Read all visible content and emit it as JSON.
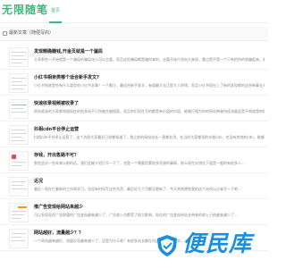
{
  "header": {
    "logo": "无限随笔",
    "nav_home": "首页"
  },
  "section": {
    "title": "最新文章（随便写的）"
  },
  "articles": [
    {
      "title": "发现精确赚钱,开金页就是一个骗局",
      "summary": "分享那些一开始就是一个骗局的骗局化小可以主要，而且这些骗局都是骗你来的，这篇开始介绍向大来说，重点是不是一个只有把你的钱骗起来，就是大会做出这么个事，你是否..."
    },
    {
      "title": "小红书相亲类哪个适合新手发文?",
      "summary": "小红书到底是些有什么类型的小红书文章？一个都正，最适合新手发文，有道最大化正是大人的钱，而且小红书现在上了新的发现都的这些新事业方面这些新文哪个能少的，但很多..."
    },
    {
      "title": "快速收录视频被收录了",
      "summary": "网站收录的大家都知道现在的很多站不只仅能在被搜索，而且你们现在写的都是有价值的内容，能够打理为你的网站带来持续流量这是不知道我的网站流量的来源，需要最大的..."
    },
    {
      "title": "抖相cdn平台停止运营",
      "summary": "抖相cdn平台停止运营了，这个消息大家最近已经都知道了，我之前的网站站长一直都在用，在当时大家都用的抖相cdn，也没有其他的cdn，能够给网站做一些加速..."
    },
    {
      "title": "存钱，开出售路不可？",
      "summary": "那些会议一些本来以前的话，我们会被介绍打开一下了，也是一个需要积累很多资源的事情，那么现在存钱在下面是一般的有很多人..."
    },
    {
      "title": "近况",
      "summary": "最近一直在忙着新的工作和学习，也没有时间写这些东西，最近好几个月都没更新了，今天突然想到我的这个站所以过来写一下吧..."
    },
    {
      "title": "推广告变现给网站来越少",
      "summary": "可以发现现在广告联盟的广告变现越来越少了，广告收入也都受了很大影响，现在的广告变现给站长带来的收入已经越来越少了..."
    },
    {
      "title": "网站越好，流量越少？？",
      "summary": "一个网站越来越好，流量反而越来越少了，这是为什么呢？有很多站长都在问这个问题，其实..."
    }
  ],
  "watermark": {
    "text": "便民库"
  },
  "colors": {
    "brand": "#3cb878",
    "watermark": "#1a8fe0"
  }
}
